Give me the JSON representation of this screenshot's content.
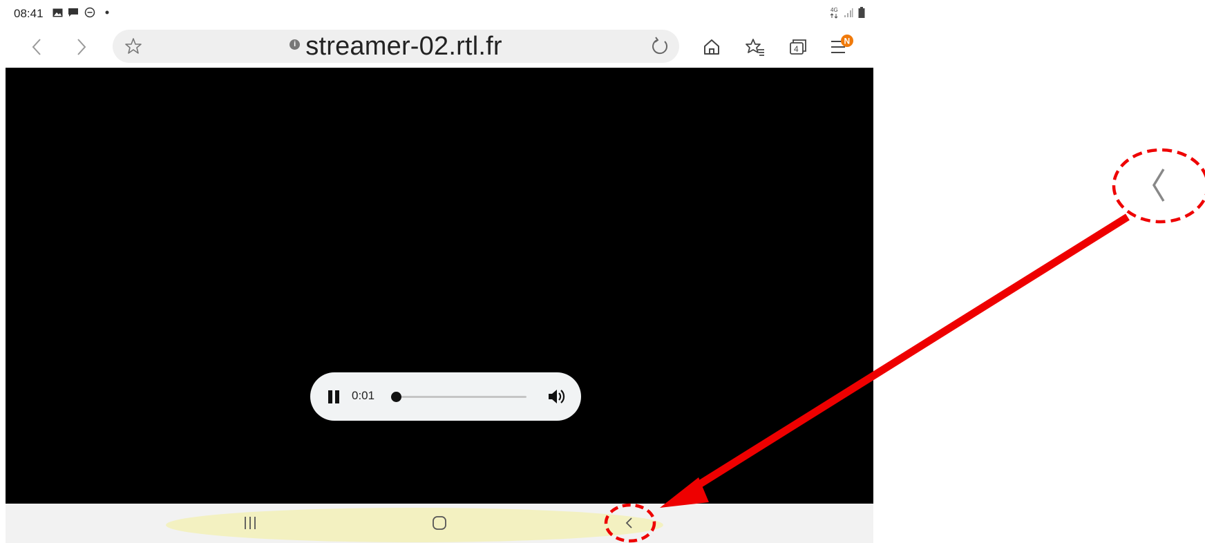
{
  "status_bar": {
    "time": "08:41",
    "left_icons": [
      "image-icon",
      "message-icon",
      "do-not-disturb-icon",
      "dot-icon"
    ],
    "right_icons": [
      "4g-data-icon",
      "signal-icon",
      "battery-icon"
    ]
  },
  "browser": {
    "url": "streamer-02.rtl.fr",
    "tab_count": "4",
    "menu_badge": "N",
    "colors": {
      "badge": "#f07a0b",
      "urlbar": "#efefef"
    }
  },
  "audio_player": {
    "current_time": "0:01",
    "state": "playing",
    "progress": 0.02
  },
  "nav_bar": {
    "buttons": [
      "recent-apps",
      "home",
      "back"
    ]
  },
  "annotation": {
    "color": "#ee0000",
    "description_icons": [
      "back-chevron-icon"
    ]
  }
}
